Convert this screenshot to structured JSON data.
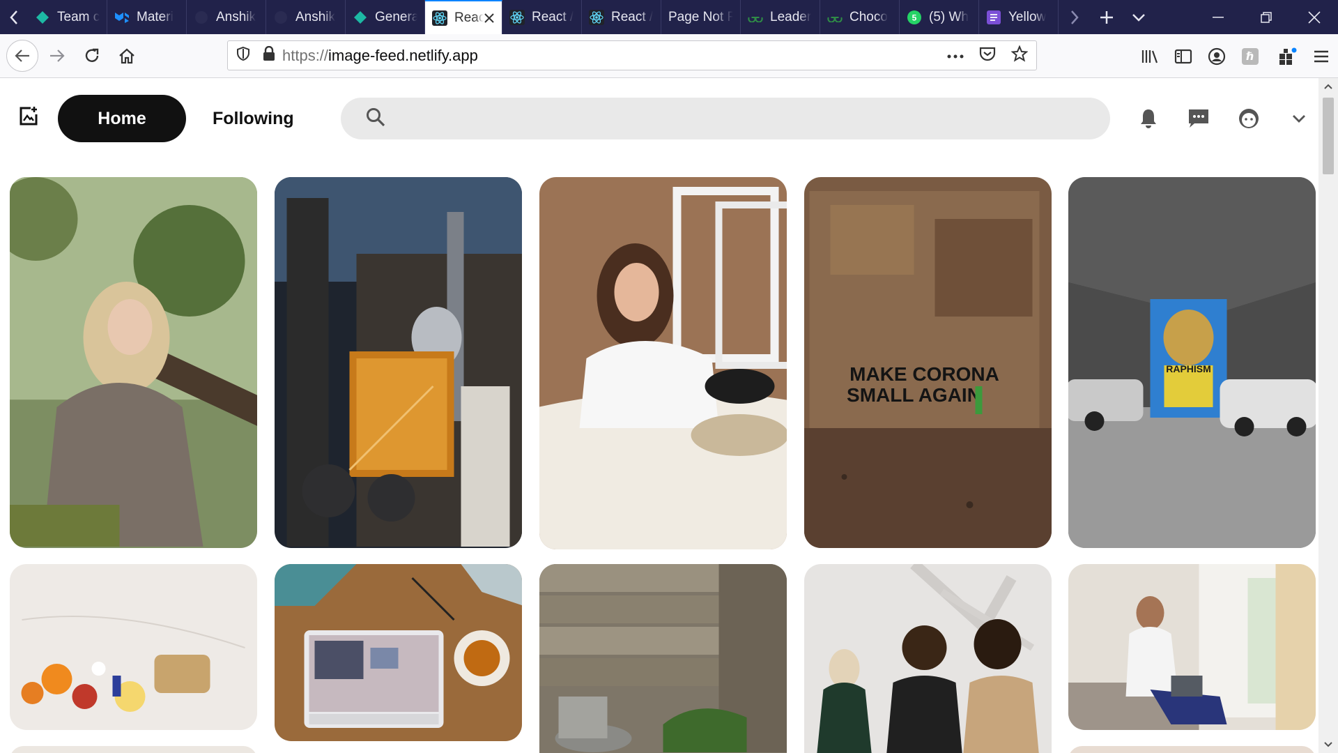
{
  "browser": {
    "tabs": [
      {
        "title": "Team c",
        "icon": "diamond-teal-icon"
      },
      {
        "title": "Materi",
        "icon": "material-ui-icon"
      },
      {
        "title": "Anshik",
        "icon": "github-icon"
      },
      {
        "title": "Anshik",
        "icon": "github-icon"
      },
      {
        "title": "Genera",
        "icon": "diamond-teal-icon"
      },
      {
        "title": "React",
        "icon": "react-icon",
        "active": true
      },
      {
        "title": "React /",
        "icon": "react-icon"
      },
      {
        "title": "React /",
        "icon": "react-icon"
      },
      {
        "title": "Page Not F",
        "icon": ""
      },
      {
        "title": "Leader",
        "icon": "gfg-icon"
      },
      {
        "title": "Choco",
        "icon": "gfg-icon"
      },
      {
        "title": "(5) Wh",
        "icon": "whatsapp-icon"
      },
      {
        "title": "Yellow",
        "icon": "purple-doc-icon"
      }
    ],
    "url_scheme": "https://",
    "url_host": "image-feed.netlify.app",
    "colors": {
      "tabbar": "#21224a",
      "active_tab_border": "#0a84ff"
    }
  },
  "app": {
    "home_label": "Home",
    "following_label": "Following",
    "search_placeholder": ""
  },
  "feed": {
    "images": [
      {
        "description": "woman-with-blonde-hair-under-tree"
      },
      {
        "description": "building-rooftop-with-satellite-dishes"
      },
      {
        "description": "woman-in-white-shirt-on-bed"
      },
      {
        "description": "graffiti-wall",
        "text": "MAKE CORONA SMALL AGAIN"
      },
      {
        "description": "parking-garage-with-mural",
        "text": "RAPHISM"
      },
      {
        "description": "food-flat-lay-on-marble"
      },
      {
        "description": "laptop-on-wooden-table-with-tea"
      },
      {
        "description": "wooden-shed-with-watering-can"
      },
      {
        "description": "three-women-in-front-of-wall"
      },
      {
        "description": "man-with-laptop-sitting-on-bed"
      }
    ]
  }
}
